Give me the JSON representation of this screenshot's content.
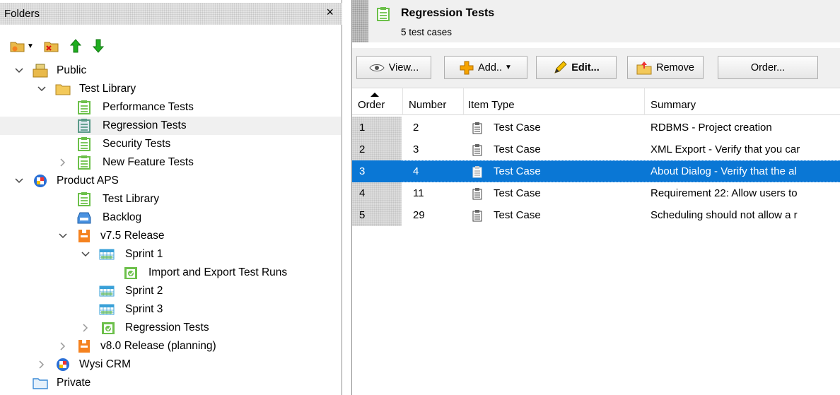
{
  "folders_panel": {
    "title": "Folders",
    "close_label": "×",
    "toolbar": [
      "new-folder-icon",
      "delete-folder-icon",
      "move-up-icon",
      "move-down-icon"
    ],
    "tree": [
      {
        "label": "Public",
        "icon": "public-folder-icon",
        "expanded": true
      },
      {
        "label": "Test Library",
        "icon": "folder-icon",
        "expanded": true
      },
      {
        "label": "Performance Tests",
        "icon": "test-set-icon"
      },
      {
        "label": "Regression Tests",
        "icon": "test-set-icon",
        "selected": true
      },
      {
        "label": "Security Tests",
        "icon": "test-set-icon"
      },
      {
        "label": "New Feature Tests",
        "icon": "test-set-icon",
        "expanded": false
      },
      {
        "label": "Product APS",
        "icon": "product-icon",
        "expanded": true
      },
      {
        "label": "Test Library",
        "icon": "test-set-icon"
      },
      {
        "label": "Backlog",
        "icon": "backlog-icon"
      },
      {
        "label": "v7.5 Release",
        "icon": "release-icon",
        "expanded": true
      },
      {
        "label": "Sprint 1",
        "icon": "sprint-icon",
        "expanded": true
      },
      {
        "label": "Import and Export Test Runs",
        "icon": "test-run-icon"
      },
      {
        "label": "Sprint 2",
        "icon": "sprint-icon"
      },
      {
        "label": "Sprint 3",
        "icon": "sprint-icon"
      },
      {
        "label": "Regression Tests",
        "icon": "test-run-icon",
        "expanded": false
      },
      {
        "label": "v8.0 Release (planning)",
        "icon": "release-icon",
        "expanded": false
      },
      {
        "label": "Wysi CRM",
        "icon": "product-icon",
        "expanded": false
      },
      {
        "label": "Private",
        "icon": "private-folder-icon"
      }
    ]
  },
  "detail": {
    "title": "Regression Tests",
    "subtitle": "5 test cases",
    "buttons": {
      "view": "View...",
      "add": "Add..",
      "edit": "Edit...",
      "remove": "Remove",
      "order": "Order..."
    },
    "columns": [
      "Order",
      "Number",
      "Item Type",
      "Summary"
    ],
    "rows": [
      {
        "order": "1",
        "number": "2",
        "type": "Test Case",
        "summary": "RDBMS - Project creation"
      },
      {
        "order": "2",
        "number": "3",
        "type": "Test Case",
        "summary": "XML Export - Verify that you car"
      },
      {
        "order": "3",
        "number": "4",
        "type": "Test Case",
        "summary": "About Dialog - Verify that the al",
        "selected": true
      },
      {
        "order": "4",
        "number": "11",
        "type": "Test Case",
        "summary": "Requirement 22: Allow users to"
      },
      {
        "order": "5",
        "number": "29",
        "type": "Test Case",
        "summary": "Scheduling should not allow a r"
      }
    ]
  },
  "colors": {
    "selection": "#0a77d5",
    "test_set_green": "#6cc04a",
    "release_orange": "#f5821f",
    "arrow_green": "#1fae1f"
  }
}
